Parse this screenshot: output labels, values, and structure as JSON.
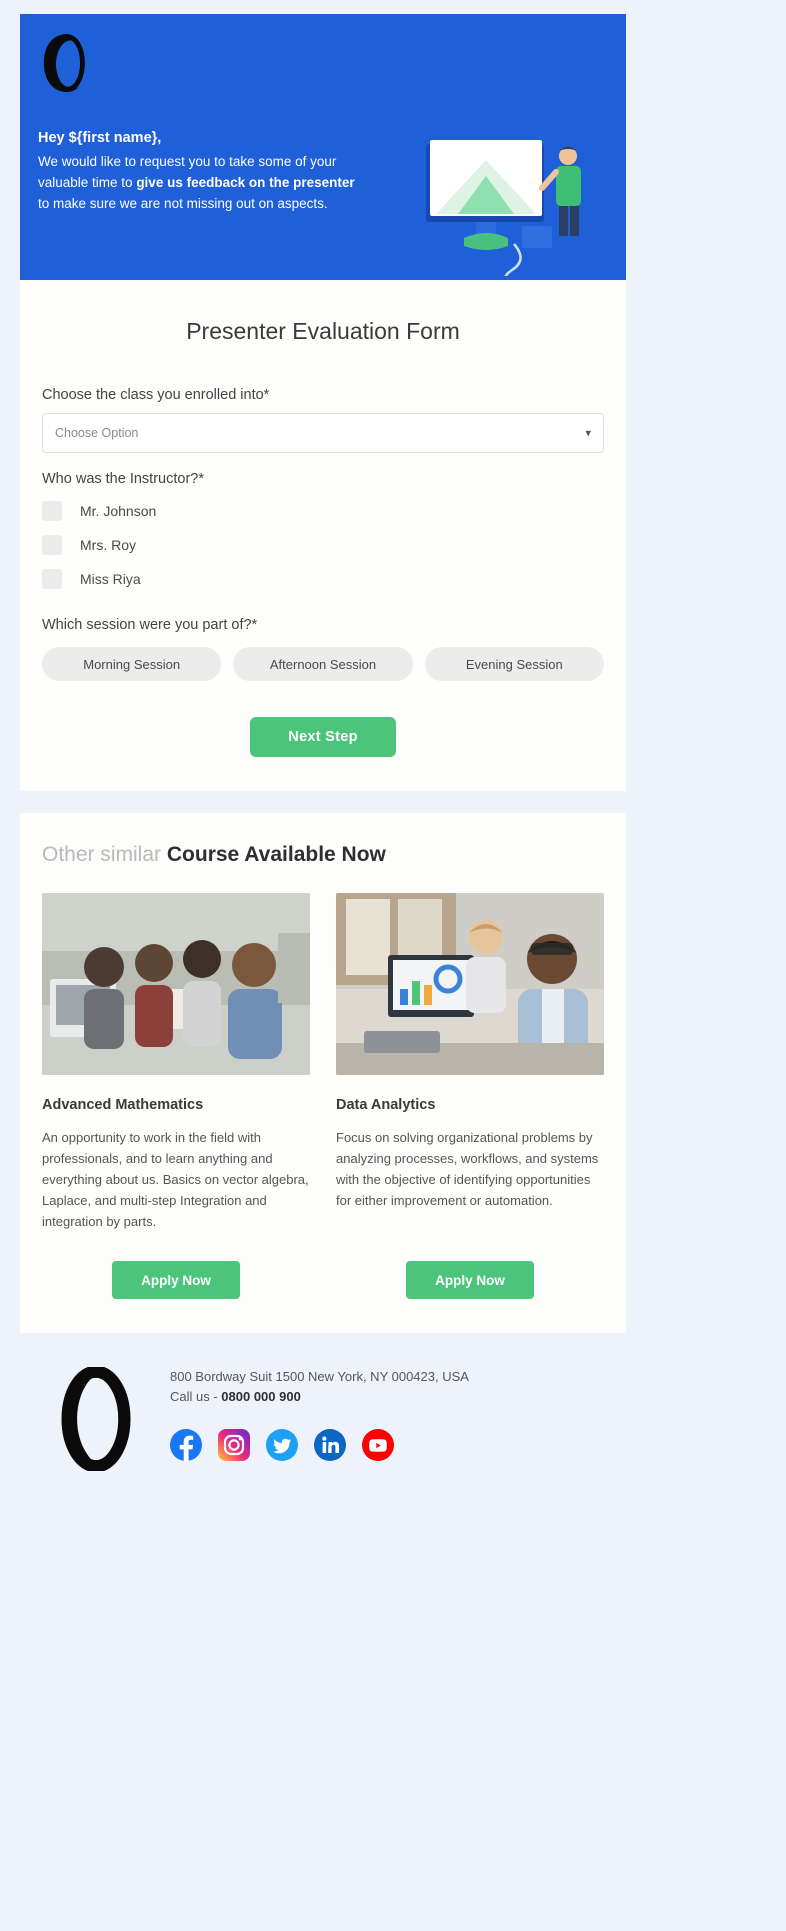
{
  "hero": {
    "logo_icon": "brand-o-logo",
    "greeting": "Hey ${first name},",
    "body_1": "We would like to request you to take some of your valuable time to ",
    "body_bold": "give us feedback on the presenter",
    "body_2": " to make sure we are not missing out on aspects.",
    "bg_color": "#1f5fd8",
    "illustration": "presenter-at-screen-illustration"
  },
  "form": {
    "title": "Presenter Evaluation Form",
    "class_question": "Choose the class you enrolled into*",
    "class_select_value": "Choose Option",
    "class_select_icon": "chevron-down-icon",
    "instructor_question": "Who was the Instructor?*",
    "instructors": [
      {
        "label": "Mr. Johnson"
      },
      {
        "label": "Mrs. Roy"
      },
      {
        "label": "Miss Riya"
      }
    ],
    "session_question": "Which session were you part of?*",
    "sessions": [
      {
        "label": "Morning Session"
      },
      {
        "label": "Afternoon Session"
      },
      {
        "label": "Evening Session"
      }
    ],
    "next_label": "Next Step",
    "button_color": "#4cc47c"
  },
  "courses": {
    "heading_muted": "Other similar",
    "heading_strong": "Course Available Now",
    "items": [
      {
        "image_alt": "students-at-computers-photo",
        "name": "Advanced Mathematics",
        "desc": "An opportunity to work in the field with professionals, and to learn anything and everything about us. Basics on vector algebra, Laplace, and multi-step Integration and integration by parts.",
        "cta": "Apply Now"
      },
      {
        "image_alt": "office-team-meeting-photo",
        "name": "Data Analytics",
        "desc": "Focus on solving organizational problems by analyzing processes, workflows, and systems with the objective of identifying opportunities for either improvement or automation.",
        "cta": "Apply Now"
      }
    ]
  },
  "footer": {
    "logo_icon": "brand-o-logo",
    "address": "800 Bordway Suit 1500 New York, NY 000423, USA",
    "call_prefix": "Call us - ",
    "phone": "0800 000 900",
    "socials": [
      {
        "name": "facebook-icon",
        "color": "#1877f2"
      },
      {
        "name": "instagram-icon",
        "color": "#e1306c"
      },
      {
        "name": "twitter-icon",
        "color": "#1da1f2"
      },
      {
        "name": "linkedin-icon",
        "color": "#0a66c2"
      },
      {
        "name": "youtube-icon",
        "color": "#ff0000"
      }
    ]
  }
}
